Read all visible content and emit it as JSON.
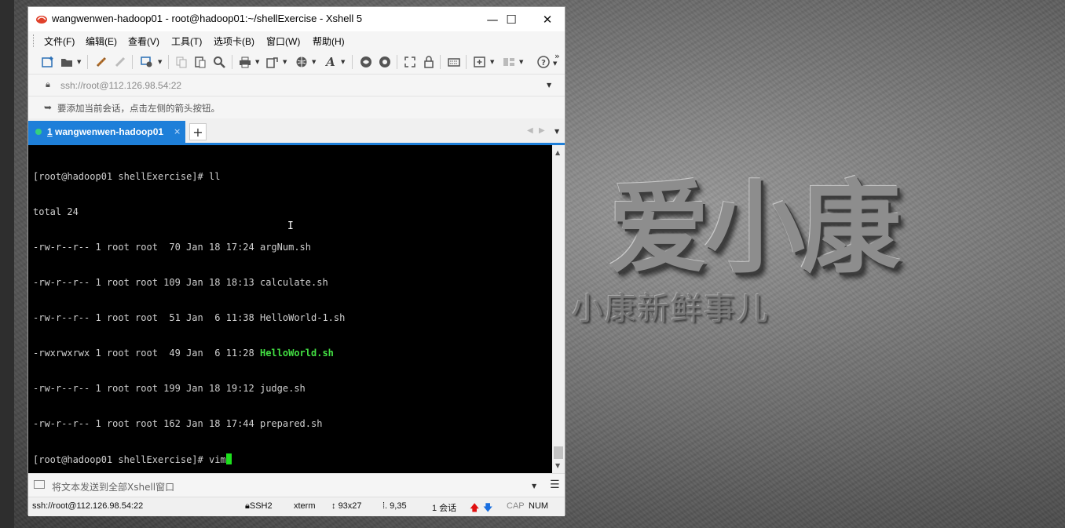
{
  "desktop": {
    "logo_main": "爱小康",
    "logo_sub": "小康新鲜事儿"
  },
  "window": {
    "title": "wangwenwen-hadoop01 - root@hadoop01:~/shellExercise - Xshell 5",
    "minimize_glyph": "—",
    "maximize_glyph": "☐",
    "close_glyph": "✕"
  },
  "menu": {
    "items": [
      "文件(F)",
      "编辑(E)",
      "查看(V)",
      "工具(T)",
      "选项卡(B)",
      "窗口(W)",
      "帮助(H)"
    ]
  },
  "toolbar": {
    "icons": [
      "new-session-icon",
      "open-folder-icon",
      "connect-icon",
      "disconnect-icon",
      "properties-icon",
      "copy-icon",
      "paste-icon",
      "find-icon",
      "print-icon",
      "transfer-icon",
      "globe-icon",
      "font-icon",
      "xftp-icon",
      "xshell-icon",
      "fullscreen-icon",
      "lock-icon",
      "keyboard-icon",
      "new-tab-icon",
      "layout-icon",
      "help-icon"
    ],
    "overflow_glyph": "»"
  },
  "address": {
    "value": "ssh://root@112.126.98.54:22"
  },
  "hint": {
    "text": "要添加当前会话，点击左侧的箭头按钮。"
  },
  "tabs": {
    "active_number": "1",
    "active_label": "wangwenwen-hadoop01",
    "close_glyph": "×",
    "add_glyph": "+",
    "status_color": "#35d07f"
  },
  "terminal": {
    "lines": [
      "[root@hadoop01 shellExercise]# ll",
      "total 24",
      "-rw-r--r-- 1 root root  70 Jan 18 17:24 argNum.sh",
      "-rw-r--r-- 1 root root 109 Jan 18 18:13 calculate.sh",
      "-rw-r--r-- 1 root root  51 Jan  6 11:38 HelloWorld-1.sh",
      "-rwxrwxrwx 1 root root  49 Jan  6 11:28 ",
      "-rw-r--r-- 1 root root 199 Jan 18 19:12 judge.sh",
      "-rw-r--r-- 1 root root 162 Jan 18 17:44 prepared.sh",
      "[root@hadoop01 shellExercise]# vim"
    ],
    "executable_file": "HelloWorld.sh",
    "executable_color": "#43e043"
  },
  "sendbar": {
    "text": "将文本发送到全部Xshell窗口"
  },
  "status": {
    "connection": "ssh://root@112.126.98.54:22",
    "protocol": "SSH2",
    "terminal_type": "xterm",
    "size": "93x27",
    "cursor_pos": "9,35",
    "sessions": "1 会话",
    "cap": "CAP",
    "num": "NUM"
  }
}
